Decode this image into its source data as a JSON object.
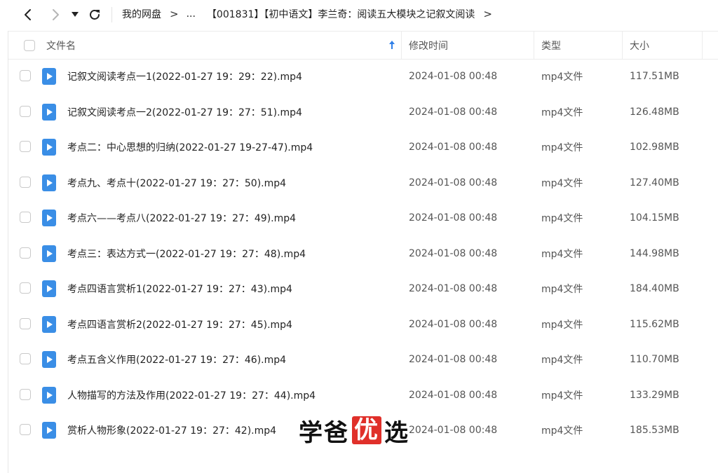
{
  "breadcrumb": {
    "root": "我的网盘",
    "ellipsis": "...",
    "current": "【001831】【初中语文】李兰奇：阅读五大模块之记叙文阅读"
  },
  "columns": {
    "name": "文件名",
    "mtime": "修改时间",
    "type": "类型",
    "size": "大小"
  },
  "colors": {
    "file_icon": "#3a8ee6",
    "watermark_highlight": "#e0302a"
  },
  "files": [
    {
      "name": "记叙文阅读考点一1(2022-01-27 19：29：22).mp4",
      "mtime": "2024-01-08 00:48",
      "type": "mp4文件",
      "size": "117.51MB"
    },
    {
      "name": "记叙文阅读考点一2(2022-01-27 19：27：51).mp4",
      "mtime": "2024-01-08 00:48",
      "type": "mp4文件",
      "size": "126.48MB"
    },
    {
      "name": "考点二：中心思想的归纳(2022-01-27 19-27-47).mp4",
      "mtime": "2024-01-08 00:48",
      "type": "mp4文件",
      "size": "102.98MB"
    },
    {
      "name": "考点九、考点十(2022-01-27 19：27：50).mp4",
      "mtime": "2024-01-08 00:48",
      "type": "mp4文件",
      "size": "127.40MB"
    },
    {
      "name": "考点六——考点八(2022-01-27 19：27：49).mp4",
      "mtime": "2024-01-08 00:48",
      "type": "mp4文件",
      "size": "104.15MB"
    },
    {
      "name": "考点三：表达方式一(2022-01-27 19：27：48).mp4",
      "mtime": "2024-01-08 00:48",
      "type": "mp4文件",
      "size": "144.98MB"
    },
    {
      "name": "考点四语言赏析1(2022-01-27 19：27：43).mp4",
      "mtime": "2024-01-08 00:48",
      "type": "mp4文件",
      "size": "184.40MB"
    },
    {
      "name": "考点四语言赏析2(2022-01-27 19：27：45).mp4",
      "mtime": "2024-01-08 00:48",
      "type": "mp4文件",
      "size": "115.62MB"
    },
    {
      "name": "考点五含义作用(2022-01-27 19：27：46).mp4",
      "mtime": "2024-01-08 00:48",
      "type": "mp4文件",
      "size": "110.70MB"
    },
    {
      "name": "人物描写的方法及作用(2022-01-27 19：27：44).mp4",
      "mtime": "2024-01-08 00:48",
      "type": "mp4文件",
      "size": "133.29MB"
    },
    {
      "name": "赏析人物形象(2022-01-27 19：27：42).mp4",
      "mtime": "2024-01-08 00:48",
      "type": "mp4文件",
      "size": "185.53MB"
    }
  ],
  "watermark": {
    "part1": "学爸",
    "highlight": "优",
    "part2": "选"
  }
}
